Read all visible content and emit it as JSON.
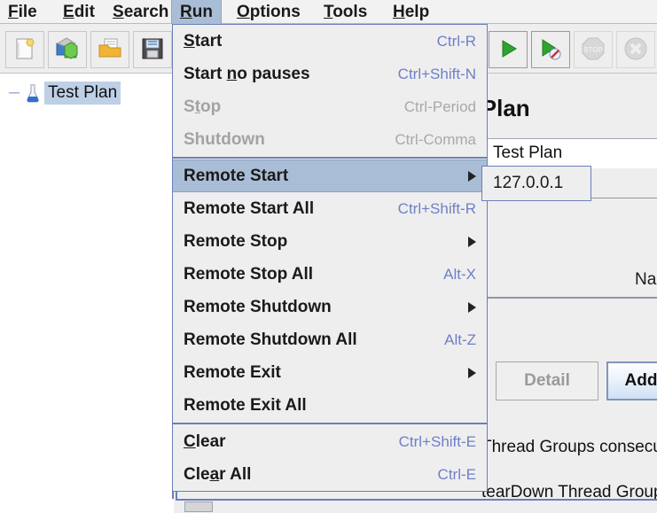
{
  "app": {
    "accent_highlight": "#a9bed6",
    "accent_border": "#6b7fb8",
    "accel_color": "#6f7fc8",
    "disabled_color": "#a3a3a3",
    "panel_bg": "#eeeeee",
    "tree_bg": "#ffffff"
  },
  "menubar": {
    "items": [
      {
        "label": "File",
        "mnemonic": "F",
        "active": false
      },
      {
        "label": "Edit",
        "mnemonic": "E",
        "active": false
      },
      {
        "label": "Search",
        "mnemonic": "S",
        "active": false
      },
      {
        "label": "Run",
        "mnemonic": "R",
        "active": true
      },
      {
        "label": "Options",
        "mnemonic": "O",
        "active": false
      },
      {
        "label": "Tools",
        "mnemonic": "T",
        "active": false
      },
      {
        "label": "Help",
        "mnemonic": "H",
        "active": false
      }
    ]
  },
  "toolbar": {
    "buttons": [
      {
        "name": "new-test-plan-button",
        "icon": "new-document-icon",
        "enabled": true
      },
      {
        "name": "templates-button",
        "icon": "templates-icon",
        "enabled": true
      },
      {
        "name": "open-button",
        "icon": "open-folder-icon",
        "enabled": true
      },
      {
        "name": "save-button",
        "icon": "floppy-disk-icon",
        "enabled": true
      },
      {
        "name": "start-button",
        "icon": "play-icon",
        "enabled": true
      },
      {
        "name": "start-no-pauses-button",
        "icon": "play-no-pauses-icon",
        "enabled": true
      },
      {
        "name": "stop-button",
        "icon": "stop-sign-icon",
        "enabled": false
      },
      {
        "name": "shutdown-button",
        "icon": "shutdown-x-icon",
        "enabled": false
      }
    ]
  },
  "tree": {
    "node": {
      "label": "Test Plan",
      "icon": "test-plan-beaker-icon",
      "expander": "─",
      "selected": true
    }
  },
  "right_panel": {
    "title": "Test Plan",
    "name_field_value": "Test Plan",
    "name_label": "Name:",
    "detail_button": "Detail",
    "add_button": "Add",
    "checkbox_1_text": "Thread Groups consecutively",
    "checkbox_2_text": "tearDown Thread Groups"
  },
  "run_menu": {
    "items": [
      {
        "label": "Start",
        "mnemonic": "S",
        "accel": "Ctrl-R",
        "enabled": true,
        "submenu": false,
        "selected": false
      },
      {
        "label": "Start no pauses",
        "mnemonic": "n",
        "accel": "Ctrl+Shift-N",
        "enabled": true,
        "submenu": false,
        "selected": false
      },
      {
        "label": "Stop",
        "mnemonic": "t",
        "accel": "Ctrl-Period",
        "enabled": false,
        "submenu": false,
        "selected": false
      },
      {
        "label": "Shutdown",
        "mnemonic": "",
        "accel": "Ctrl-Comma",
        "enabled": false,
        "submenu": false,
        "selected": false
      },
      {
        "separator": true
      },
      {
        "label": "Remote Start",
        "mnemonic": "",
        "accel": "",
        "enabled": true,
        "submenu": true,
        "selected": true
      },
      {
        "label": "Remote Start All",
        "mnemonic": "",
        "accel": "Ctrl+Shift-R",
        "enabled": true,
        "submenu": false,
        "selected": false
      },
      {
        "label": "Remote Stop",
        "mnemonic": "",
        "accel": "",
        "enabled": true,
        "submenu": true,
        "selected": false
      },
      {
        "label": "Remote Stop All",
        "mnemonic": "",
        "accel": "Alt-X",
        "enabled": true,
        "submenu": false,
        "selected": false
      },
      {
        "label": "Remote Shutdown",
        "mnemonic": "",
        "accel": "",
        "enabled": true,
        "submenu": true,
        "selected": false
      },
      {
        "label": "Remote Shutdown All",
        "mnemonic": "",
        "accel": "Alt-Z",
        "enabled": true,
        "submenu": false,
        "selected": false
      },
      {
        "label": "Remote Exit",
        "mnemonic": "",
        "accel": "",
        "enabled": true,
        "submenu": true,
        "selected": false
      },
      {
        "label": "Remote Exit All",
        "mnemonic": "",
        "accel": "",
        "enabled": true,
        "submenu": false,
        "selected": false
      },
      {
        "separator": true
      },
      {
        "label": "Clear",
        "mnemonic": "C",
        "accel": "Ctrl+Shift-E",
        "enabled": true,
        "submenu": false,
        "selected": false
      },
      {
        "label": "Clear All",
        "mnemonic": "a",
        "accel": "Ctrl-E",
        "enabled": true,
        "submenu": false,
        "selected": false
      }
    ]
  },
  "remote_start_submenu": {
    "items": [
      {
        "label": "127.0.0.1"
      }
    ]
  }
}
